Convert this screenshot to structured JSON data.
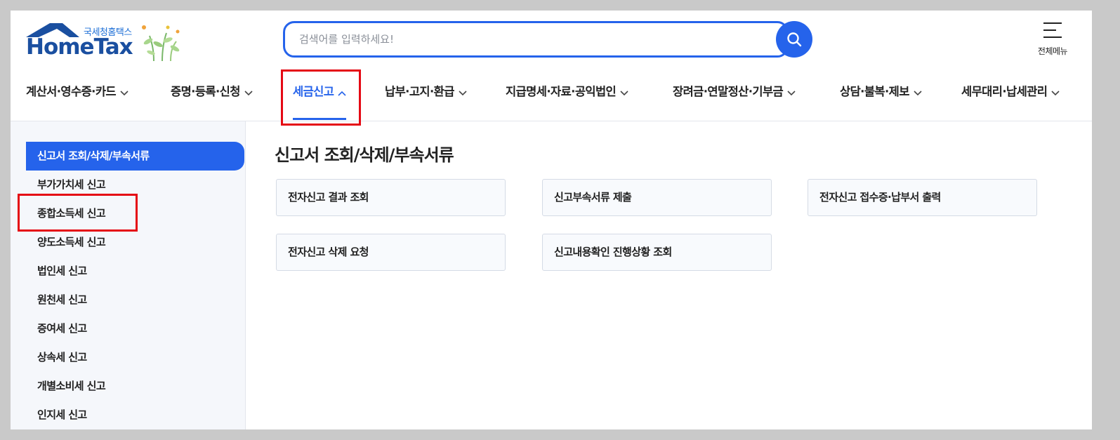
{
  "header": {
    "logo_sub": "국세청홈택스",
    "logo_main": "HomeTax",
    "search_placeholder": "검색어를 입력하세요!",
    "all_menu_label": "전체메뉴"
  },
  "gnb": [
    {
      "label": "계산서·영수증·카드",
      "active": false
    },
    {
      "label": "증명·등록·신청",
      "active": false
    },
    {
      "label": "세금신고",
      "active": true
    },
    {
      "label": "납부·고지·환급",
      "active": false
    },
    {
      "label": "지급명세·자료·공익법인",
      "active": false
    },
    {
      "label": "장려금·연말정산·기부금",
      "active": false
    },
    {
      "label": "상담·불복·제보",
      "active": false
    },
    {
      "label": "세무대리·납세관리",
      "active": false
    }
  ],
  "sidebar": {
    "items": [
      {
        "label": "신고서 조회/삭제/부속서류",
        "active": true
      },
      {
        "label": "부가가치세 신고"
      },
      {
        "label": "종합소득세 신고"
      },
      {
        "label": "양도소득세 신고"
      },
      {
        "label": "법인세 신고"
      },
      {
        "label": "원천세 신고"
      },
      {
        "label": "증여세 신고"
      },
      {
        "label": "상속세 신고"
      },
      {
        "label": "개별소비세 신고"
      },
      {
        "label": "인지세 신고"
      }
    ]
  },
  "content": {
    "title": "신고서 조회/삭제/부속서류",
    "cards": [
      "전자신고 결과 조회",
      "신고부속서류 제출",
      "전자신고 접수증·납부서 출력",
      "전자신고 삭제 요청",
      "신고내용확인 진행상황 조회"
    ]
  },
  "colors": {
    "accent": "#2563eb",
    "highlight": "#e50914",
    "sidebar_bg": "#f5f7fb",
    "backdrop": "#c9c9c9"
  },
  "icons": {
    "search": "search-icon",
    "menu": "hamburger-icon",
    "chevron": "chevron-down-icon",
    "chevron_active": "chevron-up-icon"
  }
}
